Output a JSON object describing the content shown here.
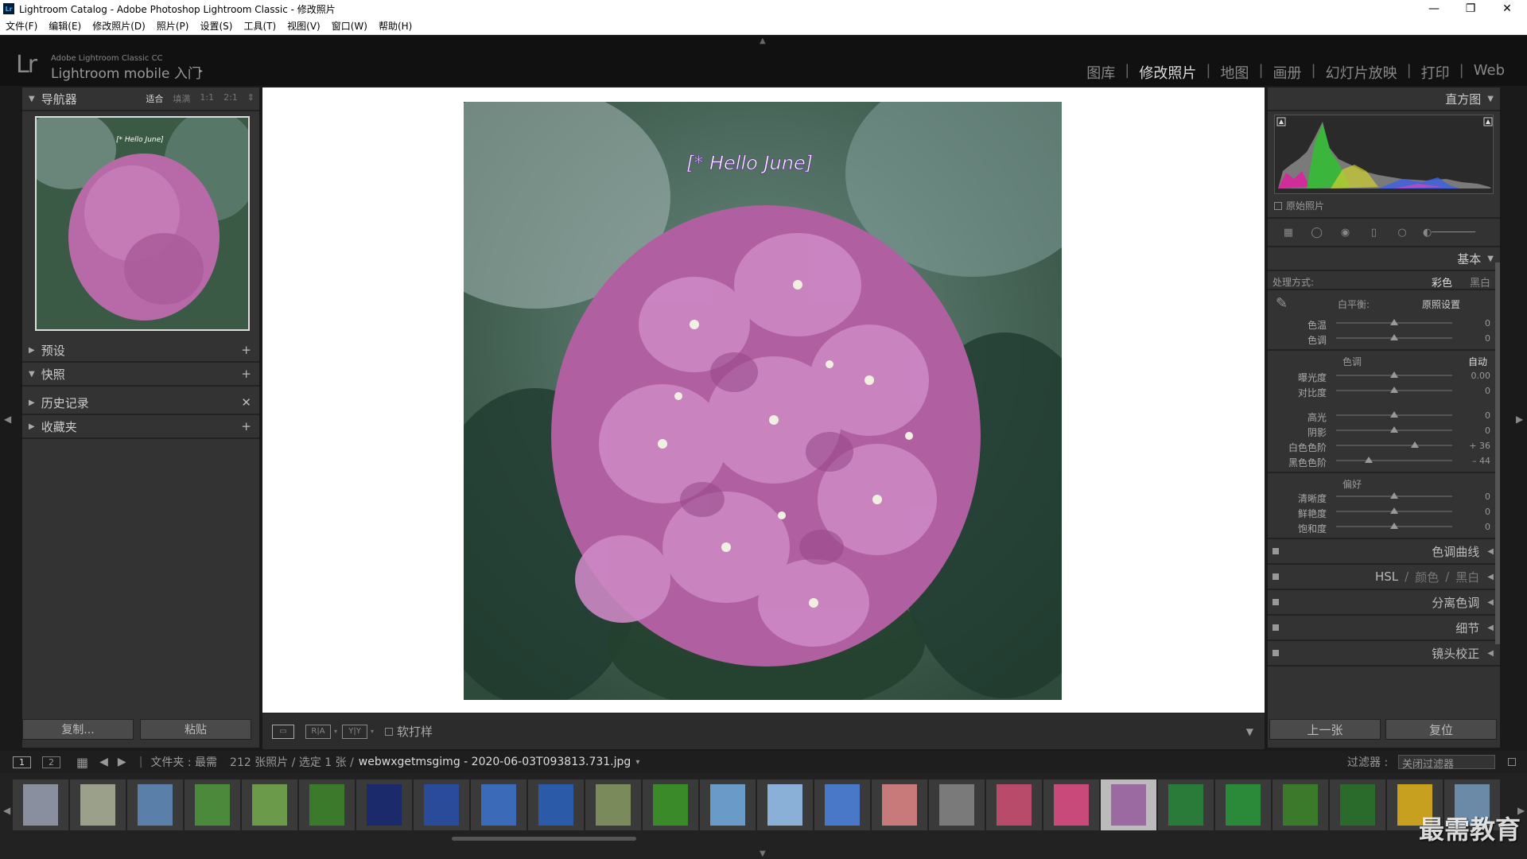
{
  "window": {
    "title": "Lightroom Catalog - Adobe Photoshop Lightroom Classic - 修改照片",
    "app_icon": "Lr",
    "controls": {
      "minimize": "—",
      "maximize": "❐",
      "close": "✕"
    }
  },
  "menu": [
    "文件(F)",
    "编辑(E)",
    "修改照片(D)",
    "照片(P)",
    "设置(S)",
    "工具(T)",
    "视图(V)",
    "窗口(W)",
    "帮助(H)"
  ],
  "identity": {
    "logo": "Lr",
    "small": "Adobe Lightroom Classic CC",
    "big": "Lightroom mobile 入门",
    "arrow": "▸"
  },
  "modules": [
    "图库",
    "修改照片",
    "地图",
    "画册",
    "幻灯片放映",
    "打印",
    "Web"
  ],
  "active_module": "修改照片",
  "left_panel": {
    "navigator": {
      "title": "导航器",
      "modes": [
        "适合",
        "填满",
        "1:1",
        "2:1"
      ],
      "active_mode": "适合"
    },
    "preview_text": "[* Hello June]",
    "panels": [
      {
        "title": "预设",
        "action": "+"
      },
      {
        "title": "快照",
        "action": "+"
      },
      {
        "title": "历史记录",
        "action": "✕"
      },
      {
        "title": "收藏夹",
        "action": "+"
      }
    ],
    "buttons": {
      "copy": "复制...",
      "paste": "粘贴"
    }
  },
  "photo": {
    "overlay_text": "[* Hello June]"
  },
  "toolbar": {
    "soft_proof": "软打样",
    "view_a": "R|A",
    "view_b": "Y|Y"
  },
  "right_panel": {
    "histogram": {
      "title": "直方图",
      "original": "原始照片"
    },
    "basic": {
      "title": "基本",
      "treatment_label": "处理方式:",
      "treatment_color": "彩色",
      "treatment_bw": "黑白",
      "wb_label": "白平衡:",
      "wb_value": "原照设置",
      "wb_sliders": [
        {
          "label": "色温",
          "value": "0",
          "pos": 0.5
        },
        {
          "label": "色调",
          "value": "0",
          "pos": 0.5
        }
      ],
      "tone_label": "色调",
      "auto": "自动",
      "tone_sliders": [
        {
          "label": "曝光度",
          "value": "0.00",
          "pos": 0.5
        },
        {
          "label": "对比度",
          "value": "0",
          "pos": 0.5
        }
      ],
      "tone_sliders_2": [
        {
          "label": "高光",
          "value": "0",
          "pos": 0.5
        },
        {
          "label": "阴影",
          "value": "0",
          "pos": 0.5
        },
        {
          "label": "白色色阶",
          "value": "+ 36",
          "pos": 0.68
        },
        {
          "label": "黑色色阶",
          "value": "– 44",
          "pos": 0.28
        }
      ],
      "presence_label": "偏好",
      "presence_sliders": [
        {
          "label": "清晰度",
          "value": "0",
          "pos": 0.5
        },
        {
          "label": "鲜艳度",
          "value": "0",
          "pos": 0.5
        },
        {
          "label": "饱和度",
          "value": "0",
          "pos": 0.5
        }
      ]
    },
    "collapsed_panels": [
      {
        "title": "色调曲线"
      },
      {
        "title": "分离色调"
      },
      {
        "title": "细节"
      },
      {
        "title": "镜头校正"
      }
    ],
    "hsl": {
      "a": "HSL",
      "b": "颜色",
      "c": "黑白",
      "sep": "/"
    },
    "buttons": {
      "prev": "上一张",
      "reset": "复位"
    }
  },
  "filmbar": {
    "page1": "1",
    "page2": "2",
    "source": "文件夹 : 最需",
    "count": "212 张照片 / 选定 1 张 /",
    "filename": "webwxgetmsgimg - 2020-06-03T093813.731.jpg",
    "filter_label": "过滤器 :",
    "filter_value": "关闭过滤器"
  },
  "filmstrip_colors": [
    "#8a8fa0",
    "#9aa08a",
    "#5a7fa8",
    "#4a8a3a",
    "#6a9a4a",
    "#3a7a2a",
    "#1a2a6a",
    "#2a4a9a",
    "#3a6ab8",
    "#2a5aa8",
    "#7a8a5a",
    "#3a8a2a",
    "#6a9ac8",
    "#8ab0d8",
    "#4a78c8",
    "#c87a7a",
    "#7a7a7a",
    "#b84a6a",
    "#c84a7a",
    "#9a6aa0",
    "#2a7a3a",
    "#2a8a3a",
    "#3a7a2a",
    "#2a6a2a",
    "#c8a020",
    "#6a8aa8"
  ],
  "filmstrip_selected": 19,
  "watermark": "最需教育"
}
